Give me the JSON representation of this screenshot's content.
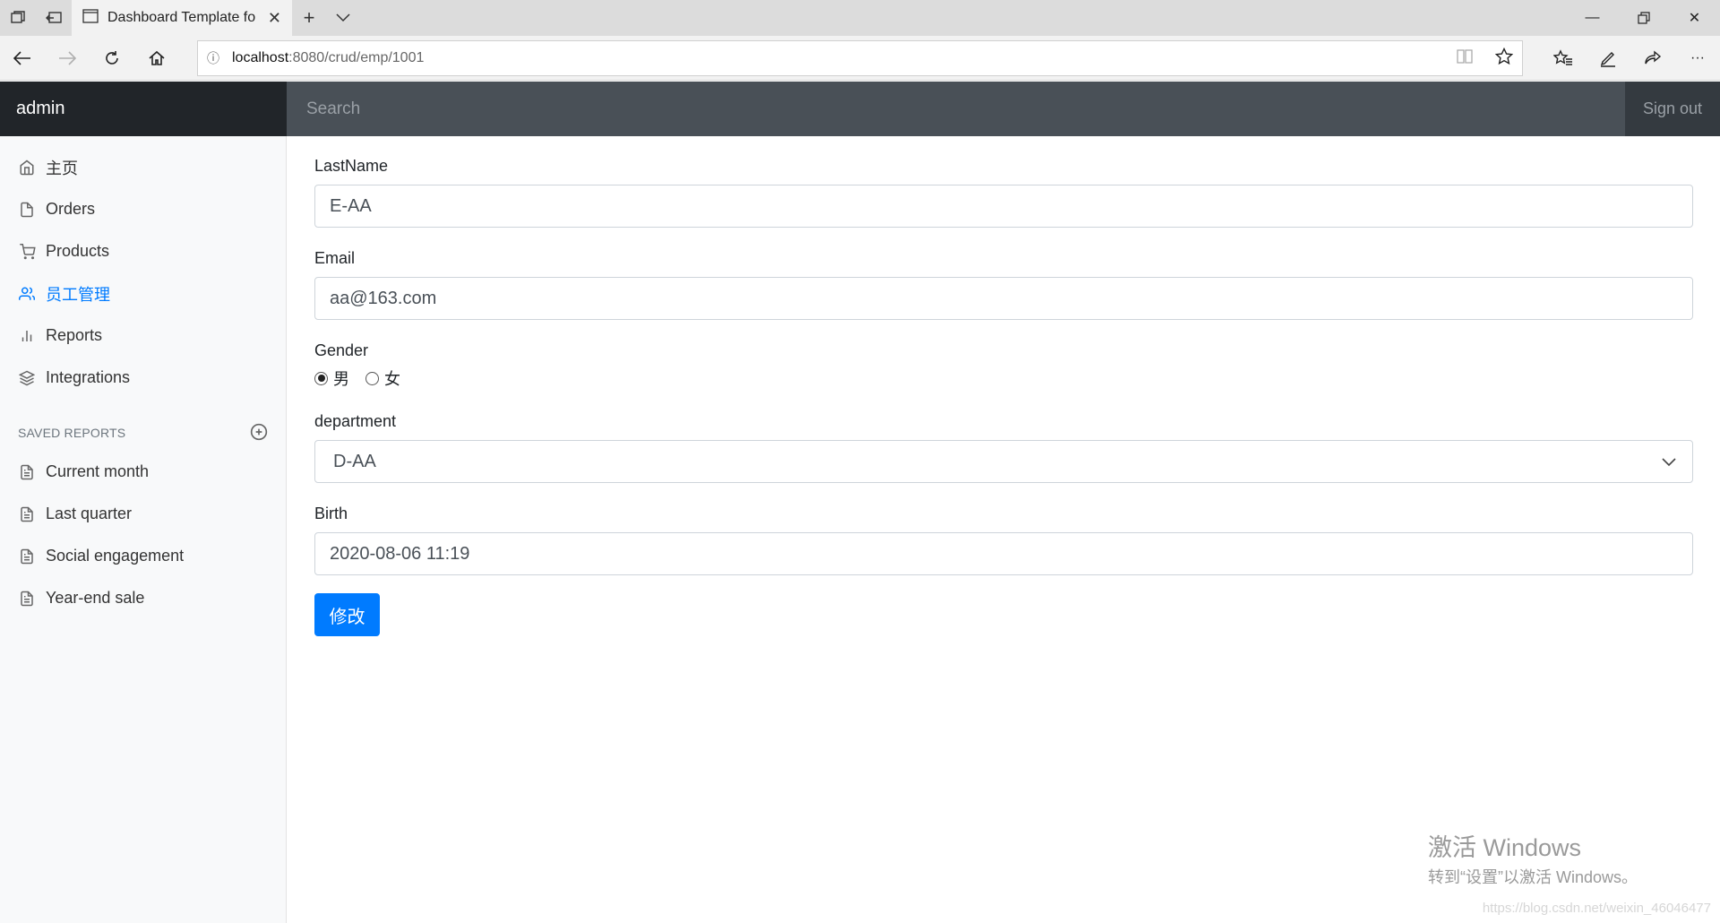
{
  "browser": {
    "tab_title": "Dashboard Template fo",
    "url_host": "localhost",
    "url_path": ":8080/crud/emp/1001"
  },
  "app": {
    "brand": "admin",
    "search_placeholder": "Search",
    "signout": "Sign out"
  },
  "sidebar": {
    "items": [
      {
        "label": "主页",
        "icon": "home-icon"
      },
      {
        "label": "Orders",
        "icon": "file-icon"
      },
      {
        "label": "Products",
        "icon": "cart-icon"
      },
      {
        "label": "员工管理",
        "icon": "users-icon",
        "active": true
      },
      {
        "label": "Reports",
        "icon": "bar-chart-icon"
      },
      {
        "label": "Integrations",
        "icon": "layers-icon"
      }
    ],
    "saved_reports_header": "SAVED REPORTS",
    "saved_reports": [
      {
        "label": "Current month"
      },
      {
        "label": "Last quarter"
      },
      {
        "label": "Social engagement"
      },
      {
        "label": "Year-end sale"
      }
    ]
  },
  "form": {
    "lastname_label": "LastName",
    "lastname_value": "E-AA",
    "email_label": "Email",
    "email_value": "aa@163.com",
    "gender_label": "Gender",
    "gender_male": "男",
    "gender_female": "女",
    "gender_selected": "男",
    "department_label": "department",
    "department_value": "D-AA",
    "birth_label": "Birth",
    "birth_value": "2020-08-06 11:19",
    "submit_label": "修改"
  },
  "watermark": {
    "line1": "激活 Windows",
    "line2": "转到“设置”以激活 Windows。",
    "url": "https://blog.csdn.net/weixin_46046477"
  },
  "colors": {
    "accent": "#007bff",
    "topbar": "#343a40",
    "brand_bg": "#212529",
    "search_bg": "#495057"
  }
}
